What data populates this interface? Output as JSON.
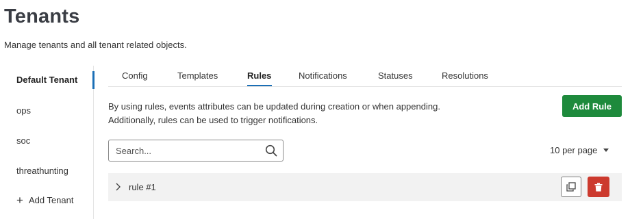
{
  "header": {
    "title": "Tenants",
    "subtitle": "Manage tenants and all tenant related objects."
  },
  "sidebar": {
    "items": [
      {
        "label": "Default Tenant",
        "active": true
      },
      {
        "label": "ops",
        "active": false
      },
      {
        "label": "soc",
        "active": false
      },
      {
        "label": "threathunting",
        "active": false
      }
    ],
    "add_label": "Add Tenant"
  },
  "tabs": [
    {
      "label": "Config",
      "active": false
    },
    {
      "label": "Templates",
      "active": false
    },
    {
      "label": "Rules",
      "active": true
    },
    {
      "label": "Notifications",
      "active": false
    },
    {
      "label": "Statuses",
      "active": false
    },
    {
      "label": "Resolutions",
      "active": false
    }
  ],
  "rules": {
    "description_line1": "By using rules, events attributes can be updated during creation or when appending.",
    "description_line2": "Additionally, rules can be used to trigger notifications.",
    "add_button_label": "Add Rule",
    "search": {
      "placeholder": "Search...",
      "value": ""
    },
    "per_page_label": "10 per page",
    "items": [
      {
        "label": "rule #1"
      }
    ]
  },
  "colors": {
    "accent": "#1b6fb6",
    "add_button": "#1e8a3c",
    "delete_button": "#cc3a2e",
    "row_background": "#f2f2f2"
  },
  "icons": {
    "search": "search-icon",
    "expand": "chevron-right-icon",
    "copy": "copy-icon",
    "delete": "trash-icon",
    "add": "plus-icon",
    "dropdown": "caret-down-icon"
  }
}
